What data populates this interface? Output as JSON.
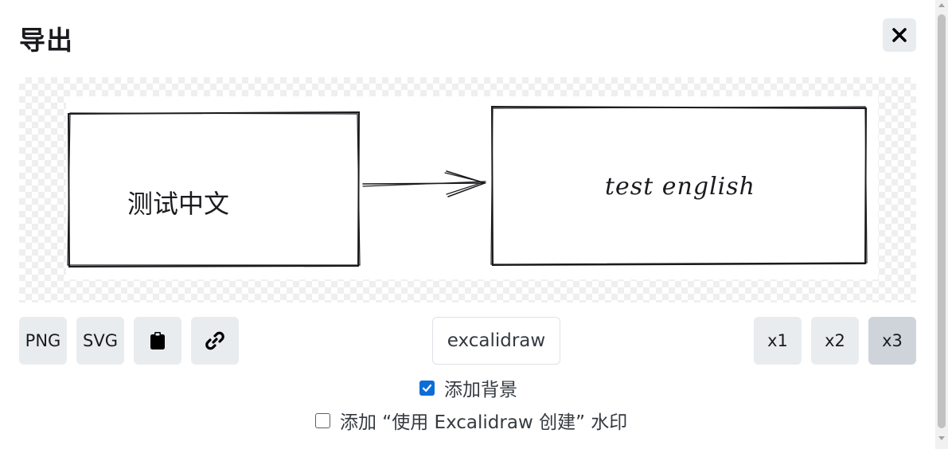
{
  "dialog": {
    "title": "导出"
  },
  "preview": {
    "shape1_text": "测试中文",
    "shape2_text": "test english"
  },
  "toolbar": {
    "png_label": "PNG",
    "svg_label": "SVG",
    "clipboard_icon": "clipboard-icon",
    "link_icon": "link-icon",
    "filename_value": "excalidraw",
    "scales": [
      "x1",
      "x2",
      "x3"
    ],
    "selected_scale": "x3"
  },
  "options": {
    "background": {
      "label": "添加背景",
      "checked": true
    },
    "watermark": {
      "label": "添加 “使用 Excalidraw 创建” 水印",
      "checked": false
    }
  },
  "colors": {
    "accent": "#0b6dd9",
    "button_bg": "#e9ecef",
    "button_active_bg": "#ced4da"
  }
}
